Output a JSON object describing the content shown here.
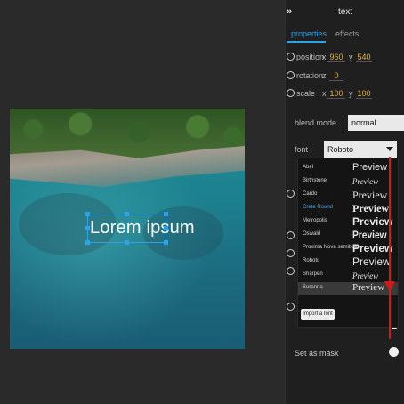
{
  "panel": {
    "title": "text",
    "tabs": [
      {
        "label": "properties",
        "active": true
      },
      {
        "label": "effects",
        "active": false
      }
    ],
    "properties": {
      "position": {
        "label": "position",
        "x_label": "x",
        "x": "960",
        "y_label": "y",
        "y": "540"
      },
      "rotation": {
        "label": "rotation",
        "z_label": "z",
        "z": "0"
      },
      "scale": {
        "label": "scale",
        "x_label": "x",
        "x": "100",
        "y_label": "y",
        "y": "100"
      }
    },
    "blend_mode": {
      "label": "blend mode",
      "value": "normal"
    },
    "font": {
      "label": "font",
      "value": "Roboto"
    },
    "font_list": [
      {
        "name": "Abel",
        "preview": "Preview"
      },
      {
        "name": "Birthstone",
        "preview": "Preview"
      },
      {
        "name": "Cardo",
        "preview": "Preview"
      },
      {
        "name": "Crete Round",
        "preview": "Preview"
      },
      {
        "name": "Metropolis",
        "preview": "Preview"
      },
      {
        "name": "Oswald",
        "preview": "Preview"
      },
      {
        "name": "Proxima Nova semibold",
        "preview": "Preview"
      },
      {
        "name": "Roboto",
        "preview": "Preview"
      },
      {
        "name": "Sharpen",
        "preview": "Preview"
      },
      {
        "name": "Suranna",
        "preview": "Preview"
      }
    ],
    "import_font_label": "Import a font",
    "set_as_mask_label": "Set as mask"
  },
  "canvas": {
    "text_layer": "Lorem ipsum"
  },
  "colors": {
    "accent_blue": "#2fa3e6",
    "value_yellow": "#e3b33a",
    "arrow_red": "#d11a1a",
    "hover_font": "#4aa8e8"
  },
  "icons": {
    "collapse": "double-chevron-right-icon",
    "reset": "reset-circle-icon"
  }
}
